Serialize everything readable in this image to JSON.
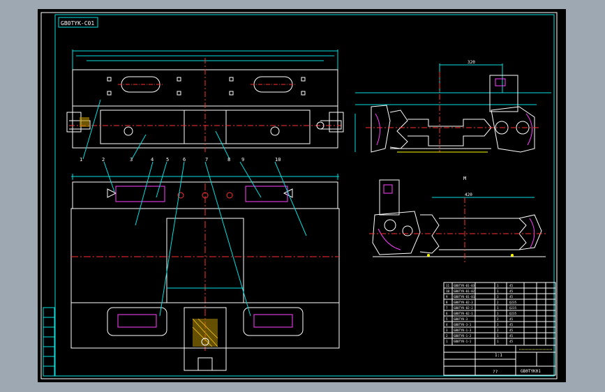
{
  "drawing": {
    "code_stamp": "GB0TYK-C01",
    "title_block": {
      "drawing_code": "GB0TYK01",
      "sheet": "1:1",
      "name": "??"
    },
    "balloons": [
      "1",
      "2",
      "3",
      "4",
      "5",
      "6",
      "7",
      "8",
      "9",
      "10"
    ],
    "view_label": "M",
    "dim_top": "320",
    "dim_mid": "420",
    "bom_rows": [
      {
        "no": "11",
        "code": "GB0TYK-01-03",
        "qty": "1",
        "mat": "45"
      },
      {
        "no": "10",
        "code": "GB0TYK-01-02",
        "qty": "1",
        "mat": "45"
      },
      {
        "no": "9",
        "code": "GB0TYK-01-01",
        "qty": "1",
        "mat": "45"
      },
      {
        "no": "8",
        "code": "GB0TYK-02-3",
        "qty": "2",
        "mat": "Q235"
      },
      {
        "no": "7",
        "code": "GB0TYK-02-2",
        "qty": "1",
        "mat": "Q235"
      },
      {
        "no": "6",
        "code": "GB0TYK-02-1",
        "qty": "1",
        "mat": "Q235"
      },
      {
        "no": "5",
        "code": "GB0TYK-3",
        "qty": "2",
        "mat": "45"
      },
      {
        "no": "4",
        "code": "GB0TYK-3-1",
        "qty": "1",
        "mat": "45"
      },
      {
        "no": "3",
        "code": "GB0TYK-1-3",
        "qty": "2",
        "mat": "45"
      },
      {
        "no": "2",
        "code": "GB0TYK-1-2",
        "qty": "1",
        "mat": "45"
      },
      {
        "no": "1",
        "code": "GB0TYK-1-1",
        "qty": "1",
        "mat": "45"
      }
    ]
  }
}
